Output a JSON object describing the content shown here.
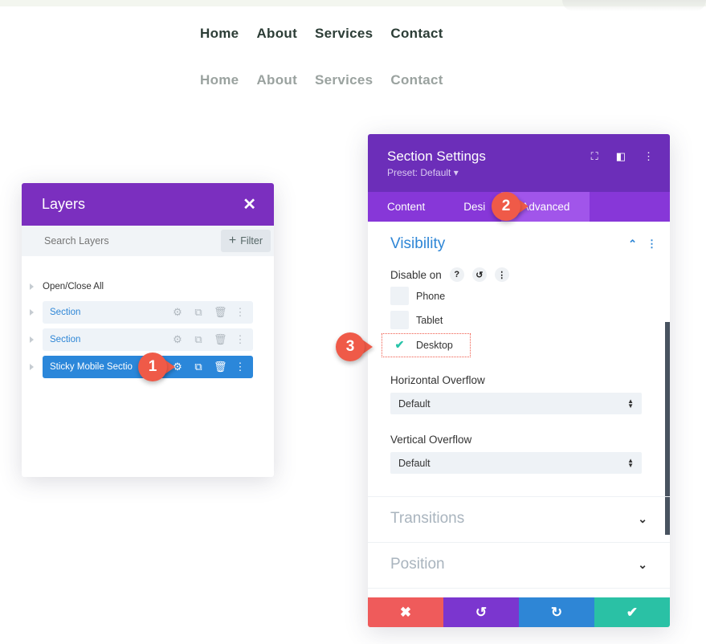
{
  "site_nav": {
    "primary": [
      "Home",
      "About",
      "Services",
      "Contact"
    ],
    "secondary": [
      "Home",
      "About",
      "Services",
      "Contact"
    ]
  },
  "layers_panel": {
    "title": "Layers",
    "close_icon": "close-icon",
    "search_placeholder": "Search Layers",
    "filter_label": "Filter",
    "open_close_all": "Open/Close All",
    "rows": [
      {
        "label": "Section"
      },
      {
        "label": "Section"
      },
      {
        "label": "Sticky Mobile Sectio"
      }
    ]
  },
  "settings_panel": {
    "title": "Section Settings",
    "preset": "Preset: Default ▾",
    "tabs": [
      "Content",
      "Desi",
      "Advanced"
    ],
    "active_tab": "Advanced",
    "visibility": {
      "title": "Visibility",
      "disable_on_label": "Disable on",
      "options": [
        {
          "label": "Phone",
          "checked": false
        },
        {
          "label": "Tablet",
          "checked": false
        },
        {
          "label": "Desktop",
          "checked": true
        }
      ]
    },
    "horizontal_overflow": {
      "label": "Horizontal Overflow",
      "value": "Default"
    },
    "vertical_overflow": {
      "label": "Vertical Overflow",
      "value": "Default"
    },
    "collapsed_sections": [
      "Transitions",
      "Position"
    ]
  },
  "callouts": [
    "1",
    "2",
    "3"
  ],
  "colors": {
    "layers_header": "#7b2fbf",
    "settings_header": "#6c2eb9",
    "tabs_bar": "#8737d8",
    "accent_blue": "#2e86d6",
    "callout_red": "#ef5a48",
    "save_green": "#2ac1a5",
    "cancel_red": "#ef5b5b"
  }
}
